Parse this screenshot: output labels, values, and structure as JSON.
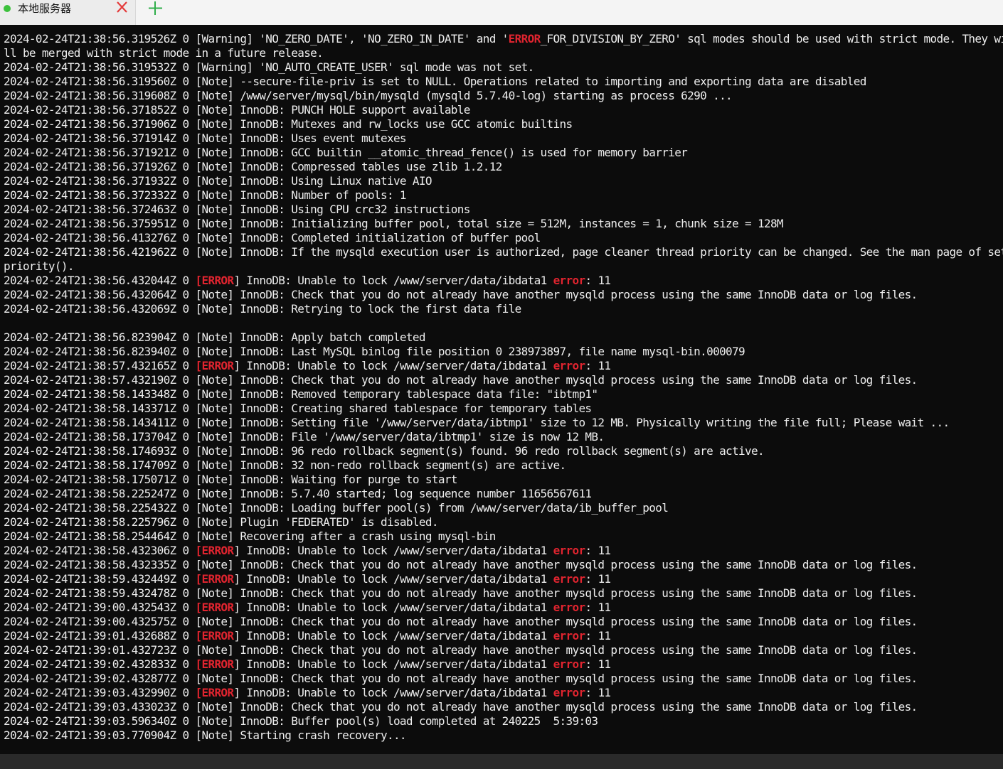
{
  "tab": {
    "title": "本地服务器",
    "status_color": "#3cc13c",
    "close_icon": "close-icon",
    "new_tab_icon": "plus-icon"
  },
  "terminal": {
    "error_color": "#e0242f",
    "lines": [
      "2024-02-24T21:38:56.319526Z 0 [Warning] 'NO_ZERO_DATE', 'NO_ZERO_IN_DATE' and '[[ERROR]]_FOR_DIVISION_BY_ZERO' sql modes should be used with strict mode. They wi",
      "ll be merged with strict mode in a future release.",
      "2024-02-24T21:38:56.319532Z 0 [Warning] 'NO_AUTO_CREATE_USER' sql mode was not set.",
      "2024-02-24T21:38:56.319560Z 0 [Note] --secure-file-priv is set to NULL. Operations related to importing and exporting data are disabled",
      "2024-02-24T21:38:56.319608Z 0 [Note] /www/server/mysql/bin/mysqld (mysqld 5.7.40-log) starting as process 6290 ...",
      "2024-02-24T21:38:56.371852Z 0 [Note] InnoDB: PUNCH HOLE support available",
      "2024-02-24T21:38:56.371906Z 0 [Note] InnoDB: Mutexes and rw_locks use GCC atomic builtins",
      "2024-02-24T21:38:56.371914Z 0 [Note] InnoDB: Uses event mutexes",
      "2024-02-24T21:38:56.371921Z 0 [Note] InnoDB: GCC builtin __atomic_thread_fence() is used for memory barrier",
      "2024-02-24T21:38:56.371926Z 0 [Note] InnoDB: Compressed tables use zlib 1.2.12",
      "2024-02-24T21:38:56.371932Z 0 [Note] InnoDB: Using Linux native AIO",
      "2024-02-24T21:38:56.372332Z 0 [Note] InnoDB: Number of pools: 1",
      "2024-02-24T21:38:56.372463Z 0 [Note] InnoDB: Using CPU crc32 instructions",
      "2024-02-24T21:38:56.375951Z 0 [Note] InnoDB: Initializing buffer pool, total size = 512M, instances = 1, chunk size = 128M",
      "2024-02-24T21:38:56.413276Z 0 [Note] InnoDB: Completed initialization of buffer pool",
      "2024-02-24T21:38:56.421962Z 0 [Note] InnoDB: If the mysqld execution user is authorized, page cleaner thread priority can be changed. See the man page of set",
      "priority().",
      "2024-02-24T21:38:56.432044Z 0 [[[ERROR]]] InnoDB: Unable to lock /www/server/data/ibdata1 [[error]]: 11",
      "2024-02-24T21:38:56.432064Z 0 [Note] InnoDB: Check that you do not already have another mysqld process using the same InnoDB data or log files.",
      "2024-02-24T21:38:56.432069Z 0 [Note] InnoDB: Retrying to lock the first data file",
      "",
      "2024-02-24T21:38:56.823904Z 0 [Note] InnoDB: Apply batch completed",
      "2024-02-24T21:38:56.823940Z 0 [Note] InnoDB: Last MySQL binlog file position 0 238973897, file name mysql-bin.000079",
      "2024-02-24T21:38:57.432165Z 0 [[[ERROR]]] InnoDB: Unable to lock /www/server/data/ibdata1 [[error]]: 11",
      "2024-02-24T21:38:57.432190Z 0 [Note] InnoDB: Check that you do not already have another mysqld process using the same InnoDB data or log files.",
      "2024-02-24T21:38:58.143348Z 0 [Note] InnoDB: Removed temporary tablespace data file: \"ibtmp1\"",
      "2024-02-24T21:38:58.143371Z 0 [Note] InnoDB: Creating shared tablespace for temporary tables",
      "2024-02-24T21:38:58.143411Z 0 [Note] InnoDB: Setting file '/www/server/data/ibtmp1' size to 12 MB. Physically writing the file full; Please wait ...",
      "2024-02-24T21:38:58.173704Z 0 [Note] InnoDB: File '/www/server/data/ibtmp1' size is now 12 MB.",
      "2024-02-24T21:38:58.174693Z 0 [Note] InnoDB: 96 redo rollback segment(s) found. 96 redo rollback segment(s) are active.",
      "2024-02-24T21:38:58.174709Z 0 [Note] InnoDB: 32 non-redo rollback segment(s) are active.",
      "2024-02-24T21:38:58.175071Z 0 [Note] InnoDB: Waiting for purge to start",
      "2024-02-24T21:38:58.225247Z 0 [Note] InnoDB: 5.7.40 started; log sequence number 11656567611",
      "2024-02-24T21:38:58.225432Z 0 [Note] InnoDB: Loading buffer pool(s) from /www/server/data/ib_buffer_pool",
      "2024-02-24T21:38:58.225796Z 0 [Note] Plugin 'FEDERATED' is disabled.",
      "2024-02-24T21:38:58.254464Z 0 [Note] Recovering after a crash using mysql-bin",
      "2024-02-24T21:38:58.432306Z 0 [[[ERROR]]] InnoDB: Unable to lock /www/server/data/ibdata1 [[error]]: 11",
      "2024-02-24T21:38:58.432335Z 0 [Note] InnoDB: Check that you do not already have another mysqld process using the same InnoDB data or log files.",
      "2024-02-24T21:38:59.432449Z 0 [[[ERROR]]] InnoDB: Unable to lock /www/server/data/ibdata1 [[error]]: 11",
      "2024-02-24T21:38:59.432478Z 0 [Note] InnoDB: Check that you do not already have another mysqld process using the same InnoDB data or log files.",
      "2024-02-24T21:39:00.432543Z 0 [[[ERROR]]] InnoDB: Unable to lock /www/server/data/ibdata1 [[error]]: 11",
      "2024-02-24T21:39:00.432575Z 0 [Note] InnoDB: Check that you do not already have another mysqld process using the same InnoDB data or log files.",
      "2024-02-24T21:39:01.432688Z 0 [[[ERROR]]] InnoDB: Unable to lock /www/server/data/ibdata1 [[error]]: 11",
      "2024-02-24T21:39:01.432723Z 0 [Note] InnoDB: Check that you do not already have another mysqld process using the same InnoDB data or log files.",
      "2024-02-24T21:39:02.432833Z 0 [[[ERROR]]] InnoDB: Unable to lock /www/server/data/ibdata1 [[error]]: 11",
      "2024-02-24T21:39:02.432877Z 0 [Note] InnoDB: Check that you do not already have another mysqld process using the same InnoDB data or log files.",
      "2024-02-24T21:39:03.432990Z 0 [[[ERROR]]] InnoDB: Unable to lock /www/server/data/ibdata1 [[error]]: 11",
      "2024-02-24T21:39:03.433023Z 0 [Note] InnoDB: Check that you do not already have another mysqld process using the same InnoDB data or log files.",
      "2024-02-24T21:39:03.596340Z 0 [Note] InnoDB: Buffer pool(s) load completed at 240225  5:39:03",
      "2024-02-24T21:39:03.770904Z 0 [Note] Starting crash recovery..."
    ]
  }
}
